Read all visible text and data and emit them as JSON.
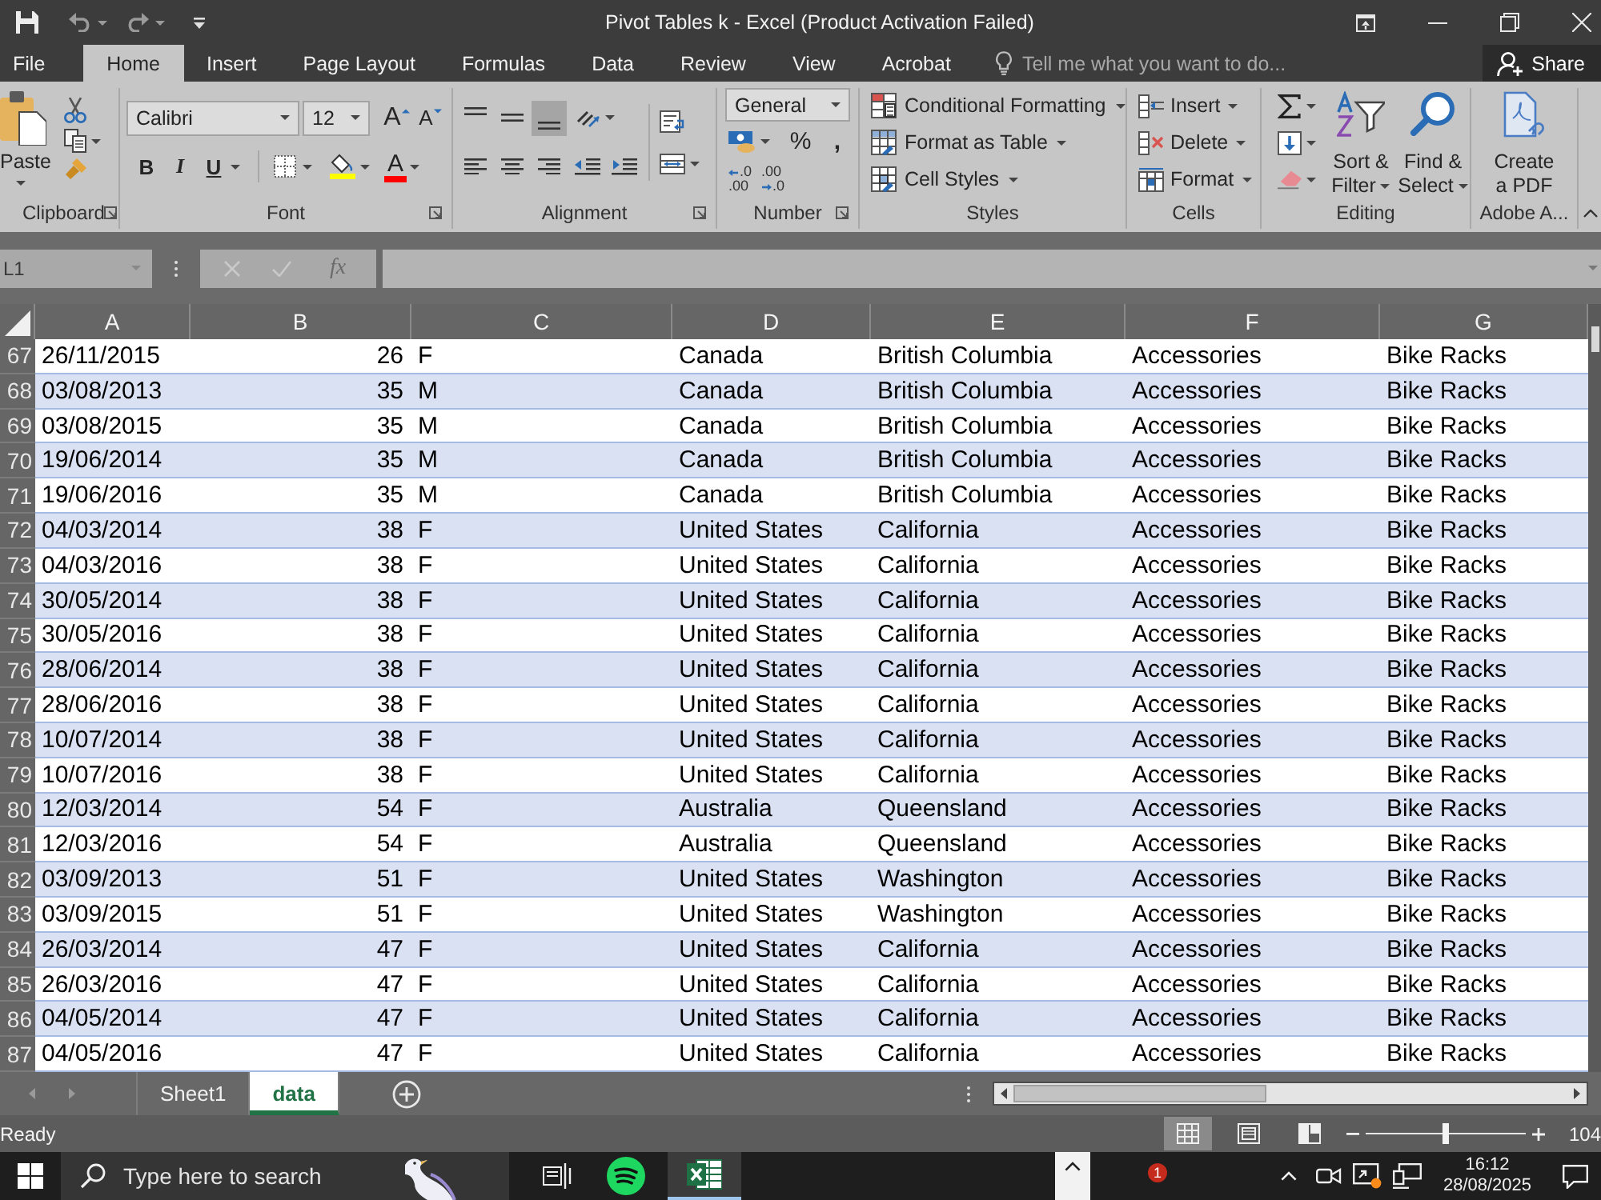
{
  "title_bar": {
    "title": "Pivot Tables k - Excel (Product Activation Failed)"
  },
  "ribbon_tabs": [
    {
      "label": "File",
      "selected": false
    },
    {
      "label": "Home",
      "selected": true
    },
    {
      "label": "Insert",
      "selected": false
    },
    {
      "label": "Page Layout",
      "selected": false
    },
    {
      "label": "Formulas",
      "selected": false
    },
    {
      "label": "Data",
      "selected": false
    },
    {
      "label": "Review",
      "selected": false
    },
    {
      "label": "View",
      "selected": false
    },
    {
      "label": "Acrobat",
      "selected": false
    }
  ],
  "tell_me": {
    "placeholder": "Tell me what you want to do..."
  },
  "share_button": {
    "label": "Share"
  },
  "ribbon": {
    "clipboard": {
      "label": "Clipboard",
      "paste": "Paste"
    },
    "font": {
      "label": "Font",
      "font_name": "Calibri",
      "font_size": "12",
      "grow": "A",
      "shrink": "A",
      "bold": "B",
      "italic": "I",
      "underline": "U",
      "font_color": "A"
    },
    "alignment": {
      "label": "Alignment",
      "vertical": [
        {
          "kind": "top",
          "selected": false
        },
        {
          "kind": "middle",
          "selected": false
        },
        {
          "kind": "bottom",
          "selected": true
        }
      ],
      "horizontal": [
        {
          "kind": "left",
          "selected": false
        },
        {
          "kind": "center",
          "selected": false
        },
        {
          "kind": "right",
          "selected": false
        }
      ]
    },
    "number": {
      "label": "Number",
      "format": "General",
      "percent": "%",
      "comma": ",",
      "increase_decimal": {
        "top": ".0",
        "bottom": ".00"
      },
      "decrease_decimal": {
        "top": ".00",
        "bottom": ".0"
      }
    },
    "styles": {
      "label": "Styles",
      "items": [
        {
          "kind": "conditional",
          "label": "Conditional Formatting"
        },
        {
          "kind": "table",
          "label": "Format as Table"
        },
        {
          "kind": "cell",
          "label": "Cell Styles"
        }
      ]
    },
    "cells": {
      "label": "Cells",
      "items": [
        {
          "kind": "insert",
          "label": "Insert"
        },
        {
          "kind": "delete",
          "label": "Delete"
        },
        {
          "kind": "format",
          "label": "Format"
        }
      ]
    },
    "editing": {
      "label": "Editing",
      "sort_filter": [
        "Sort &",
        "Filter"
      ],
      "find_select": [
        "Find &",
        "Select"
      ]
    },
    "adobe": {
      "label": "Adobe A...",
      "create_pdf": [
        "Create",
        "a PDF"
      ]
    }
  },
  "formula_bar": {
    "name_box": "L1",
    "function_label": "fx"
  },
  "sheet": {
    "columns": [
      "A",
      "B",
      "C",
      "D",
      "E",
      "F",
      "G"
    ],
    "rows": [
      {
        "number": "67",
        "cells": [
          "26/11/2015",
          "26",
          "F",
          "Canada",
          "British Columbia",
          "Accessories",
          "Bike Racks"
        ]
      },
      {
        "number": "68",
        "cells": [
          "03/08/2013",
          "35",
          "M",
          "Canada",
          "British Columbia",
          "Accessories",
          "Bike Racks"
        ]
      },
      {
        "number": "69",
        "cells": [
          "03/08/2015",
          "35",
          "M",
          "Canada",
          "British Columbia",
          "Accessories",
          "Bike Racks"
        ]
      },
      {
        "number": "70",
        "cells": [
          "19/06/2014",
          "35",
          "M",
          "Canada",
          "British Columbia",
          "Accessories",
          "Bike Racks"
        ]
      },
      {
        "number": "71",
        "cells": [
          "19/06/2016",
          "35",
          "M",
          "Canada",
          "British Columbia",
          "Accessories",
          "Bike Racks"
        ]
      },
      {
        "number": "72",
        "cells": [
          "04/03/2014",
          "38",
          "F",
          "United States",
          "California",
          "Accessories",
          "Bike Racks"
        ]
      },
      {
        "number": "73",
        "cells": [
          "04/03/2016",
          "38",
          "F",
          "United States",
          "California",
          "Accessories",
          "Bike Racks"
        ]
      },
      {
        "number": "74",
        "cells": [
          "30/05/2014",
          "38",
          "F",
          "United States",
          "California",
          "Accessories",
          "Bike Racks"
        ]
      },
      {
        "number": "75",
        "cells": [
          "30/05/2016",
          "38",
          "F",
          "United States",
          "California",
          "Accessories",
          "Bike Racks"
        ]
      },
      {
        "number": "76",
        "cells": [
          "28/06/2014",
          "38",
          "F",
          "United States",
          "California",
          "Accessories",
          "Bike Racks"
        ]
      },
      {
        "number": "77",
        "cells": [
          "28/06/2016",
          "38",
          "F",
          "United States",
          "California",
          "Accessories",
          "Bike Racks"
        ]
      },
      {
        "number": "78",
        "cells": [
          "10/07/2014",
          "38",
          "F",
          "United States",
          "California",
          "Accessories",
          "Bike Racks"
        ]
      },
      {
        "number": "79",
        "cells": [
          "10/07/2016",
          "38",
          "F",
          "United States",
          "California",
          "Accessories",
          "Bike Racks"
        ]
      },
      {
        "number": "80",
        "cells": [
          "12/03/2014",
          "54",
          "F",
          "Australia",
          "Queensland",
          "Accessories",
          "Bike Racks"
        ]
      },
      {
        "number": "81",
        "cells": [
          "12/03/2016",
          "54",
          "F",
          "Australia",
          "Queensland",
          "Accessories",
          "Bike Racks"
        ]
      },
      {
        "number": "82",
        "cells": [
          "03/09/2013",
          "51",
          "F",
          "United States",
          "Washington",
          "Accessories",
          "Bike Racks"
        ]
      },
      {
        "number": "83",
        "cells": [
          "03/09/2015",
          "51",
          "F",
          "United States",
          "Washington",
          "Accessories",
          "Bike Racks"
        ]
      },
      {
        "number": "84",
        "cells": [
          "26/03/2014",
          "47",
          "F",
          "United States",
          "California",
          "Accessories",
          "Bike Racks"
        ]
      },
      {
        "number": "85",
        "cells": [
          "26/03/2016",
          "47",
          "F",
          "United States",
          "California",
          "Accessories",
          "Bike Racks"
        ]
      },
      {
        "number": "86",
        "cells": [
          "04/05/2014",
          "47",
          "F",
          "United States",
          "California",
          "Accessories",
          "Bike Racks"
        ]
      },
      {
        "number": "87",
        "cells": [
          "04/05/2016",
          "47",
          "F",
          "United States",
          "California",
          "Accessories",
          "Bike Racks"
        ]
      }
    ]
  },
  "sheet_tabs": [
    {
      "label": "Sheet1",
      "selected": false
    },
    {
      "label": "data",
      "selected": true
    }
  ],
  "status_bar": {
    "status": "Ready",
    "views": [
      {
        "kind": "normal",
        "selected": true
      },
      {
        "kind": "page_layout",
        "selected": false
      },
      {
        "kind": "page_break",
        "selected": false
      }
    ],
    "zoom": {
      "level": 0.5,
      "reading": "104"
    }
  },
  "taskbar": {
    "search_placeholder": "Type here to search",
    "apps": [
      {
        "kind": "task_view",
        "selected": false
      },
      {
        "kind": "spotify",
        "selected": false
      },
      {
        "kind": "excel",
        "selected": true
      }
    ],
    "notification_count": "1",
    "time": "16:12",
    "date": "28/08/2025"
  }
}
